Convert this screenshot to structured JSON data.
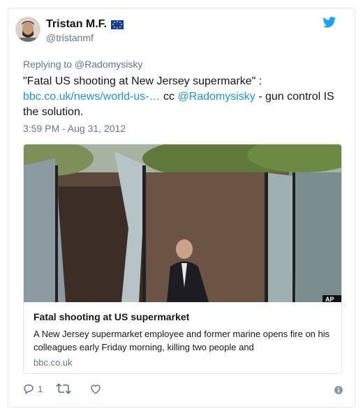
{
  "user": {
    "display_name": "Tristan M.F.",
    "handle": "@tristanmf"
  },
  "reply": {
    "text": "Replying to @Radomysisky"
  },
  "tweet": {
    "text_quote": "\"Fatal US shooting at New Jersey supermarke\" :",
    "link_text": "bbc.co.uk/news/world-us-…",
    "cc_text": " cc ",
    "mention": "@Radomysisky",
    "tail_text": " - gun control IS the solution.",
    "timestamp": "3:59 PM - Aug 31, 2012"
  },
  "card": {
    "title": "Fatal shooting at US supermarket",
    "description": "A New Jersey supermarket employee and former marine opens fire on his colleagues early Friday morning, killing two people and",
    "domain": "bbc.co.uk",
    "image_corner_text": "AP"
  },
  "actions": {
    "reply_count": "1"
  },
  "colors": {
    "link": "#1b95e0",
    "secondary": "#657786",
    "border": "#e1e8ed",
    "bird": "#1da1f2"
  },
  "icons": [
    "eu-flag-icon",
    "twitter-bird-icon",
    "reply-icon",
    "retweet-icon",
    "like-icon",
    "info-icon"
  ]
}
